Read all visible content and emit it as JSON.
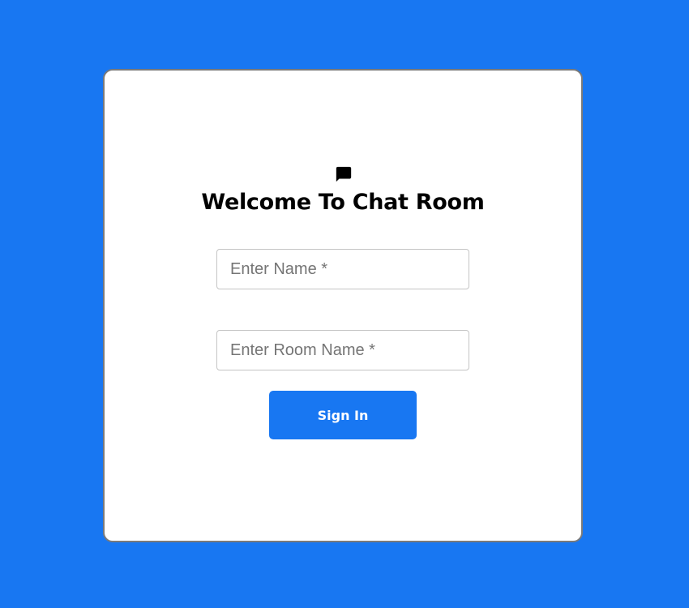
{
  "login": {
    "title": "Welcome To Chat Room",
    "icon": "chat-icon",
    "name_placeholder": "Enter Name *",
    "name_value": "",
    "room_placeholder": "Enter Room Name *",
    "room_value": "",
    "signin_label": "Sign In"
  },
  "colors": {
    "background": "#1877f2",
    "card": "#ffffff",
    "button": "#1877f2",
    "button_text": "#ffffff"
  }
}
